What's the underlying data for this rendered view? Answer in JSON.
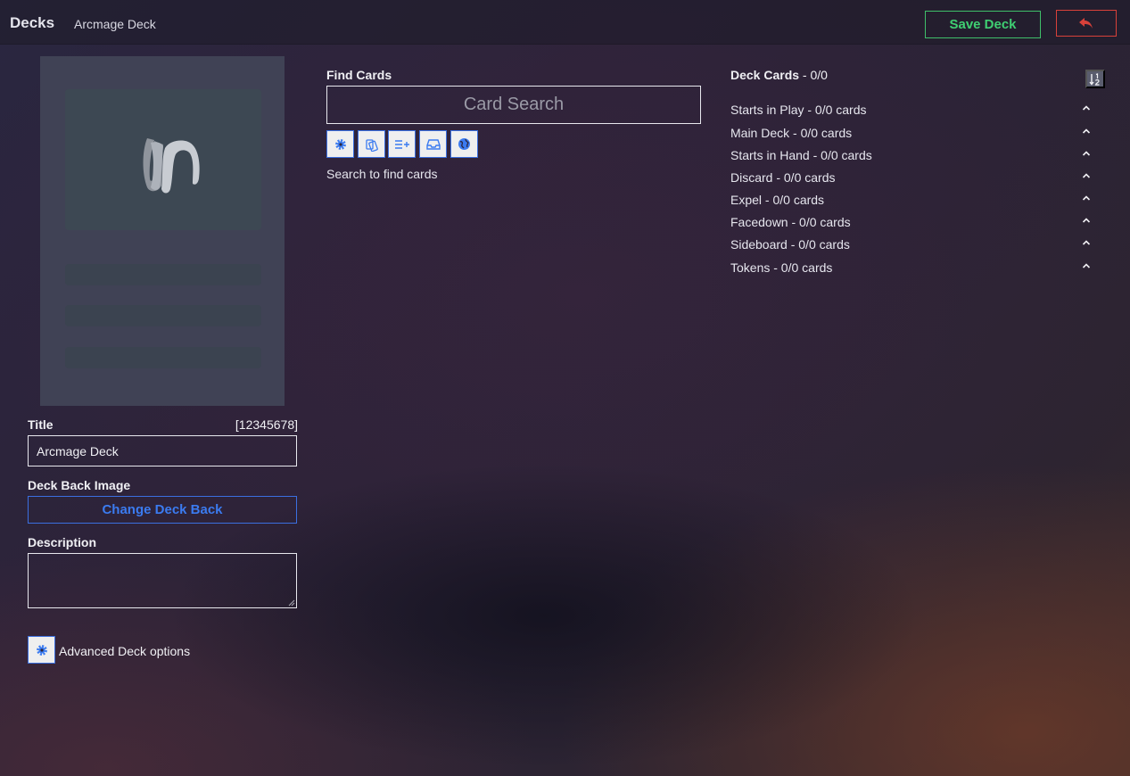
{
  "header": {
    "title": "Decks",
    "subtitle": "Arcmage Deck",
    "save_label": "Save Deck",
    "back_icon": "undo-arrow-icon",
    "colors": {
      "save": "#3fcf72",
      "back": "#d8413a",
      "accent": "#3b7bf0"
    }
  },
  "left": {
    "card_back_icon": "arcmage-logo",
    "title_label": "Title",
    "deck_id": "[12345678]",
    "title_value": "Arcmage Deck",
    "back_image_label": "Deck Back Image",
    "change_back_label": "Change Deck Back",
    "description_label": "Description",
    "description_value": "",
    "advanced_label": "Advanced Deck options"
  },
  "find": {
    "heading": "Find Cards",
    "search_placeholder": "Card Search",
    "tools": [
      "gear-icon",
      "cards-icon",
      "list-add-icon",
      "inbox-icon",
      "globe-icon"
    ],
    "hint": "Search to find cards"
  },
  "deck": {
    "heading": "Deck Cards",
    "count": " - 0/0",
    "sort_icon": "sort-numeric-icon",
    "zones": [
      {
        "label": "Starts in Play - 0/0 cards"
      },
      {
        "label": "Main Deck - 0/0 cards"
      },
      {
        "label": "Starts in Hand - 0/0 cards"
      },
      {
        "label": "Discard - 0/0 cards"
      },
      {
        "label": "Expel - 0/0 cards"
      },
      {
        "label": "Facedown - 0/0 cards"
      },
      {
        "label": "Sideboard - 0/0 cards"
      },
      {
        "label": "Tokens - 0/0 cards"
      }
    ]
  }
}
